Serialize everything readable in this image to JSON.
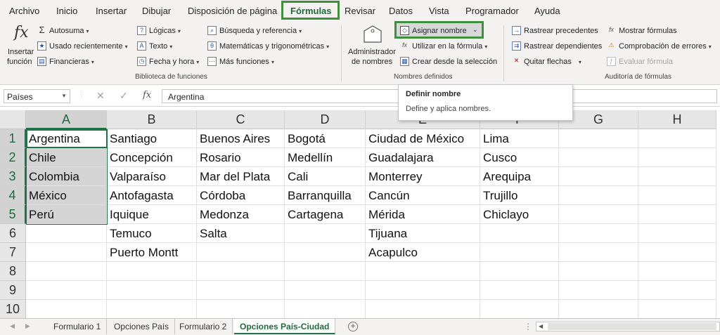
{
  "menu": {
    "tabs": [
      "Archivo",
      "Inicio",
      "Insertar",
      "Dibujar",
      "Disposición de página",
      "Fórmulas",
      "Revisar",
      "Datos",
      "Vista",
      "Programador",
      "Ayuda"
    ],
    "active": "Fórmulas"
  },
  "ribbon": {
    "insert_function": [
      "Insertar",
      "función"
    ],
    "library": {
      "autosum": "Autosuma",
      "recent": "Usado recientemente",
      "financial": "Financieras",
      "logical": "Lógicas",
      "text": "Texto",
      "datetime": "Fecha y hora",
      "lookup": "Búsqueda y referencia",
      "math": "Matemáticas y trigonométricas",
      "more": "Más funciones",
      "group_label": "Biblioteca de funciones"
    },
    "names": {
      "name_manager": [
        "Administrador",
        "de nombres"
      ],
      "define_name": "Asignar nombre",
      "use_in_formula": "Utilizar en la fórmula",
      "create_from_selection": "Crear desde la selección",
      "group_label": "Nombres definidos"
    },
    "audit": {
      "trace_precedents": "Rastrear precedentes",
      "trace_dependents": "Rastrear dependientes",
      "remove_arrows": "Quitar flechas",
      "show_formulas": "Mostrar fórmulas",
      "error_checking": "Comprobación de errores",
      "evaluate_formula": "Evaluar fórmula",
      "group_label": "Auditoría de fórmulas"
    }
  },
  "formula_bar": {
    "name_box": "Países",
    "fx": "fx",
    "value": "Argentina"
  },
  "tooltip": {
    "title": "Definir nombre",
    "description": "Define y aplica nombres."
  },
  "sheet": {
    "columns": [
      "A",
      "B",
      "C",
      "D",
      "E",
      "F",
      "G",
      "H"
    ],
    "rows": [
      "1",
      "2",
      "3",
      "4",
      "5",
      "6",
      "7",
      "8",
      "9",
      "10"
    ],
    "cells": {
      "A": [
        "Argentina",
        "Chile",
        "Colombia",
        "México",
        "Perú",
        "",
        "",
        "",
        "",
        ""
      ],
      "B": [
        "Santiago",
        "Concepción",
        "Valparaíso",
        "Antofagasta",
        "Iquique",
        "Temuco",
        "Puerto Montt",
        "",
        "",
        ""
      ],
      "C": [
        "Buenos Aires",
        "Rosario",
        "Mar del Plata",
        "Córdoba",
        "Medonza",
        "Salta",
        "",
        "",
        "",
        ""
      ],
      "D": [
        "Bogotá",
        "Medellín",
        "Cali",
        "Barranquilla",
        "Cartagena",
        "",
        "",
        "",
        "",
        ""
      ],
      "E": [
        "Ciudad de México",
        "Guadalajara",
        "Monterrey",
        "Cancún",
        "Mérida",
        "Tijuana",
        "Acapulco",
        "",
        "",
        ""
      ],
      "F": [
        "Lima",
        "Cusco",
        "Arequipa",
        "Trujillo",
        "Chiclayo",
        "",
        "",
        "",
        "",
        ""
      ]
    }
  },
  "sheet_tabs": [
    "Formulario 1",
    "Opciones País",
    "Formulario 2",
    "Opciones País-Ciudad"
  ],
  "active_sheet": "Opciones País-Ciudad",
  "colors": {
    "excel_green": "#217346",
    "highlight_box": "#3f8f3f"
  }
}
